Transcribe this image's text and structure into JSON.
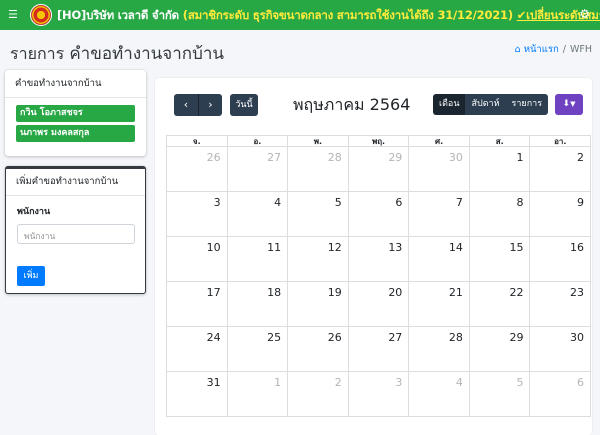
{
  "header": {
    "menu_icon": "hamburger-icon",
    "company": "[HO]บริษัท เวลาดี จำกัด",
    "membership": "(สมาชิกระดับ ธุรกิจขนาดกลาง สามารถใช้งานได้ถึง 31/12/2021)",
    "upgrade_link": "✔เปลี่ยนระดับสมาชิก",
    "settings_icon": "gear-icon"
  },
  "page": {
    "title_prefix": "รายการ",
    "title_main": "คำขอทำงานจากบ้าน",
    "breadcrumb_home": "หน้าแรก",
    "breadcrumb_current": "WFH"
  },
  "sidebar": {
    "list_card_title": "คำขอทำงานจากบ้าน",
    "employees": [
      "กวิน โอภาสชจร",
      "นภาพร มงคลสกุล"
    ],
    "form_card_title": "เพิ่มคำขอทำงานจากบ้าน",
    "employee_label": "พนักงาน",
    "employee_placeholder": "พนักงาน",
    "add_button": "เพิ่ม"
  },
  "calendar": {
    "prev_icon": "chevron-left-icon",
    "next_icon": "chevron-right-icon",
    "today_button": "วันนี้",
    "month_title": "พฤษภาคม 2564",
    "views": [
      "เดือน",
      "สัปดาห์",
      "รายการ"
    ],
    "active_view": "เดือน",
    "download_icon": "download-icon",
    "weekdays": [
      "จ.",
      "อ.",
      "พ.",
      "พฤ.",
      "ศ.",
      "ส.",
      "อา."
    ],
    "weeks": [
      [
        "26",
        "27",
        "28",
        "29",
        "30",
        "1",
        "2"
      ],
      [
        "3",
        "4",
        "5",
        "6",
        "7",
        "8",
        "9"
      ],
      [
        "10",
        "11",
        "12",
        "13",
        "14",
        "15",
        "16"
      ],
      [
        "17",
        "18",
        "19",
        "20",
        "21",
        "22",
        "23"
      ],
      [
        "24",
        "25",
        "26",
        "27",
        "28",
        "29",
        "30"
      ],
      [
        "31",
        "1",
        "2",
        "3",
        "4",
        "5",
        "6"
      ]
    ],
    "other_month": [
      [
        true,
        true,
        true,
        true,
        true,
        false,
        false
      ],
      [
        false,
        false,
        false,
        false,
        false,
        false,
        false
      ],
      [
        false,
        false,
        false,
        false,
        false,
        false,
        false
      ],
      [
        false,
        false,
        false,
        false,
        false,
        false,
        false
      ],
      [
        false,
        false,
        false,
        false,
        false,
        false,
        false
      ],
      [
        false,
        true,
        true,
        true,
        true,
        true,
        true
      ]
    ]
  },
  "colors": {
    "topbar": "#28a745",
    "nav_dark": "#2c3e50",
    "primary": "#007bff",
    "purple": "#6f42c1"
  }
}
